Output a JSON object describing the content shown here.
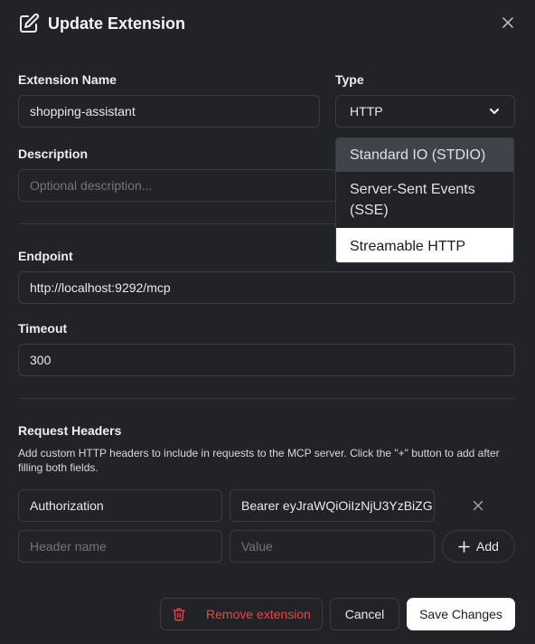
{
  "dialog": {
    "title": "Update Extension",
    "close_icon": "close-icon",
    "title_icon": "edit-icon"
  },
  "form": {
    "name_label": "Extension Name",
    "name_value": "shopping-assistant",
    "type_label": "Type",
    "type_value": "HTTP",
    "type_options": [
      "Standard IO (STDIO)",
      "Server-Sent Events (SSE)",
      "Streamable HTTP"
    ],
    "type_highlighted": "Standard IO (STDIO)",
    "type_selected": "Streamable HTTP",
    "description_label": "Description",
    "description_placeholder": "Optional description...",
    "endpoint_label": "Endpoint",
    "endpoint_value": "http://localhost:9292/mcp",
    "timeout_label": "Timeout",
    "timeout_value": "300"
  },
  "headers": {
    "title": "Request Headers",
    "help": "Add custom HTTP headers to include in requests to the MCP server. Click the \"+\" button to add after filling both fields.",
    "rows": [
      {
        "name": "Authorization",
        "value": "Bearer eyJraWQiOiIzNjU3YzBiZG"
      }
    ],
    "name_placeholder": "Header name",
    "value_placeholder": "Value",
    "add_label": "Add"
  },
  "footer": {
    "remove_label": "Remove extension",
    "cancel_label": "Cancel",
    "save_label": "Save Changes"
  },
  "colors": {
    "background": "#212327",
    "danger": "#ef4444",
    "primary_bg": "#ffffff"
  }
}
